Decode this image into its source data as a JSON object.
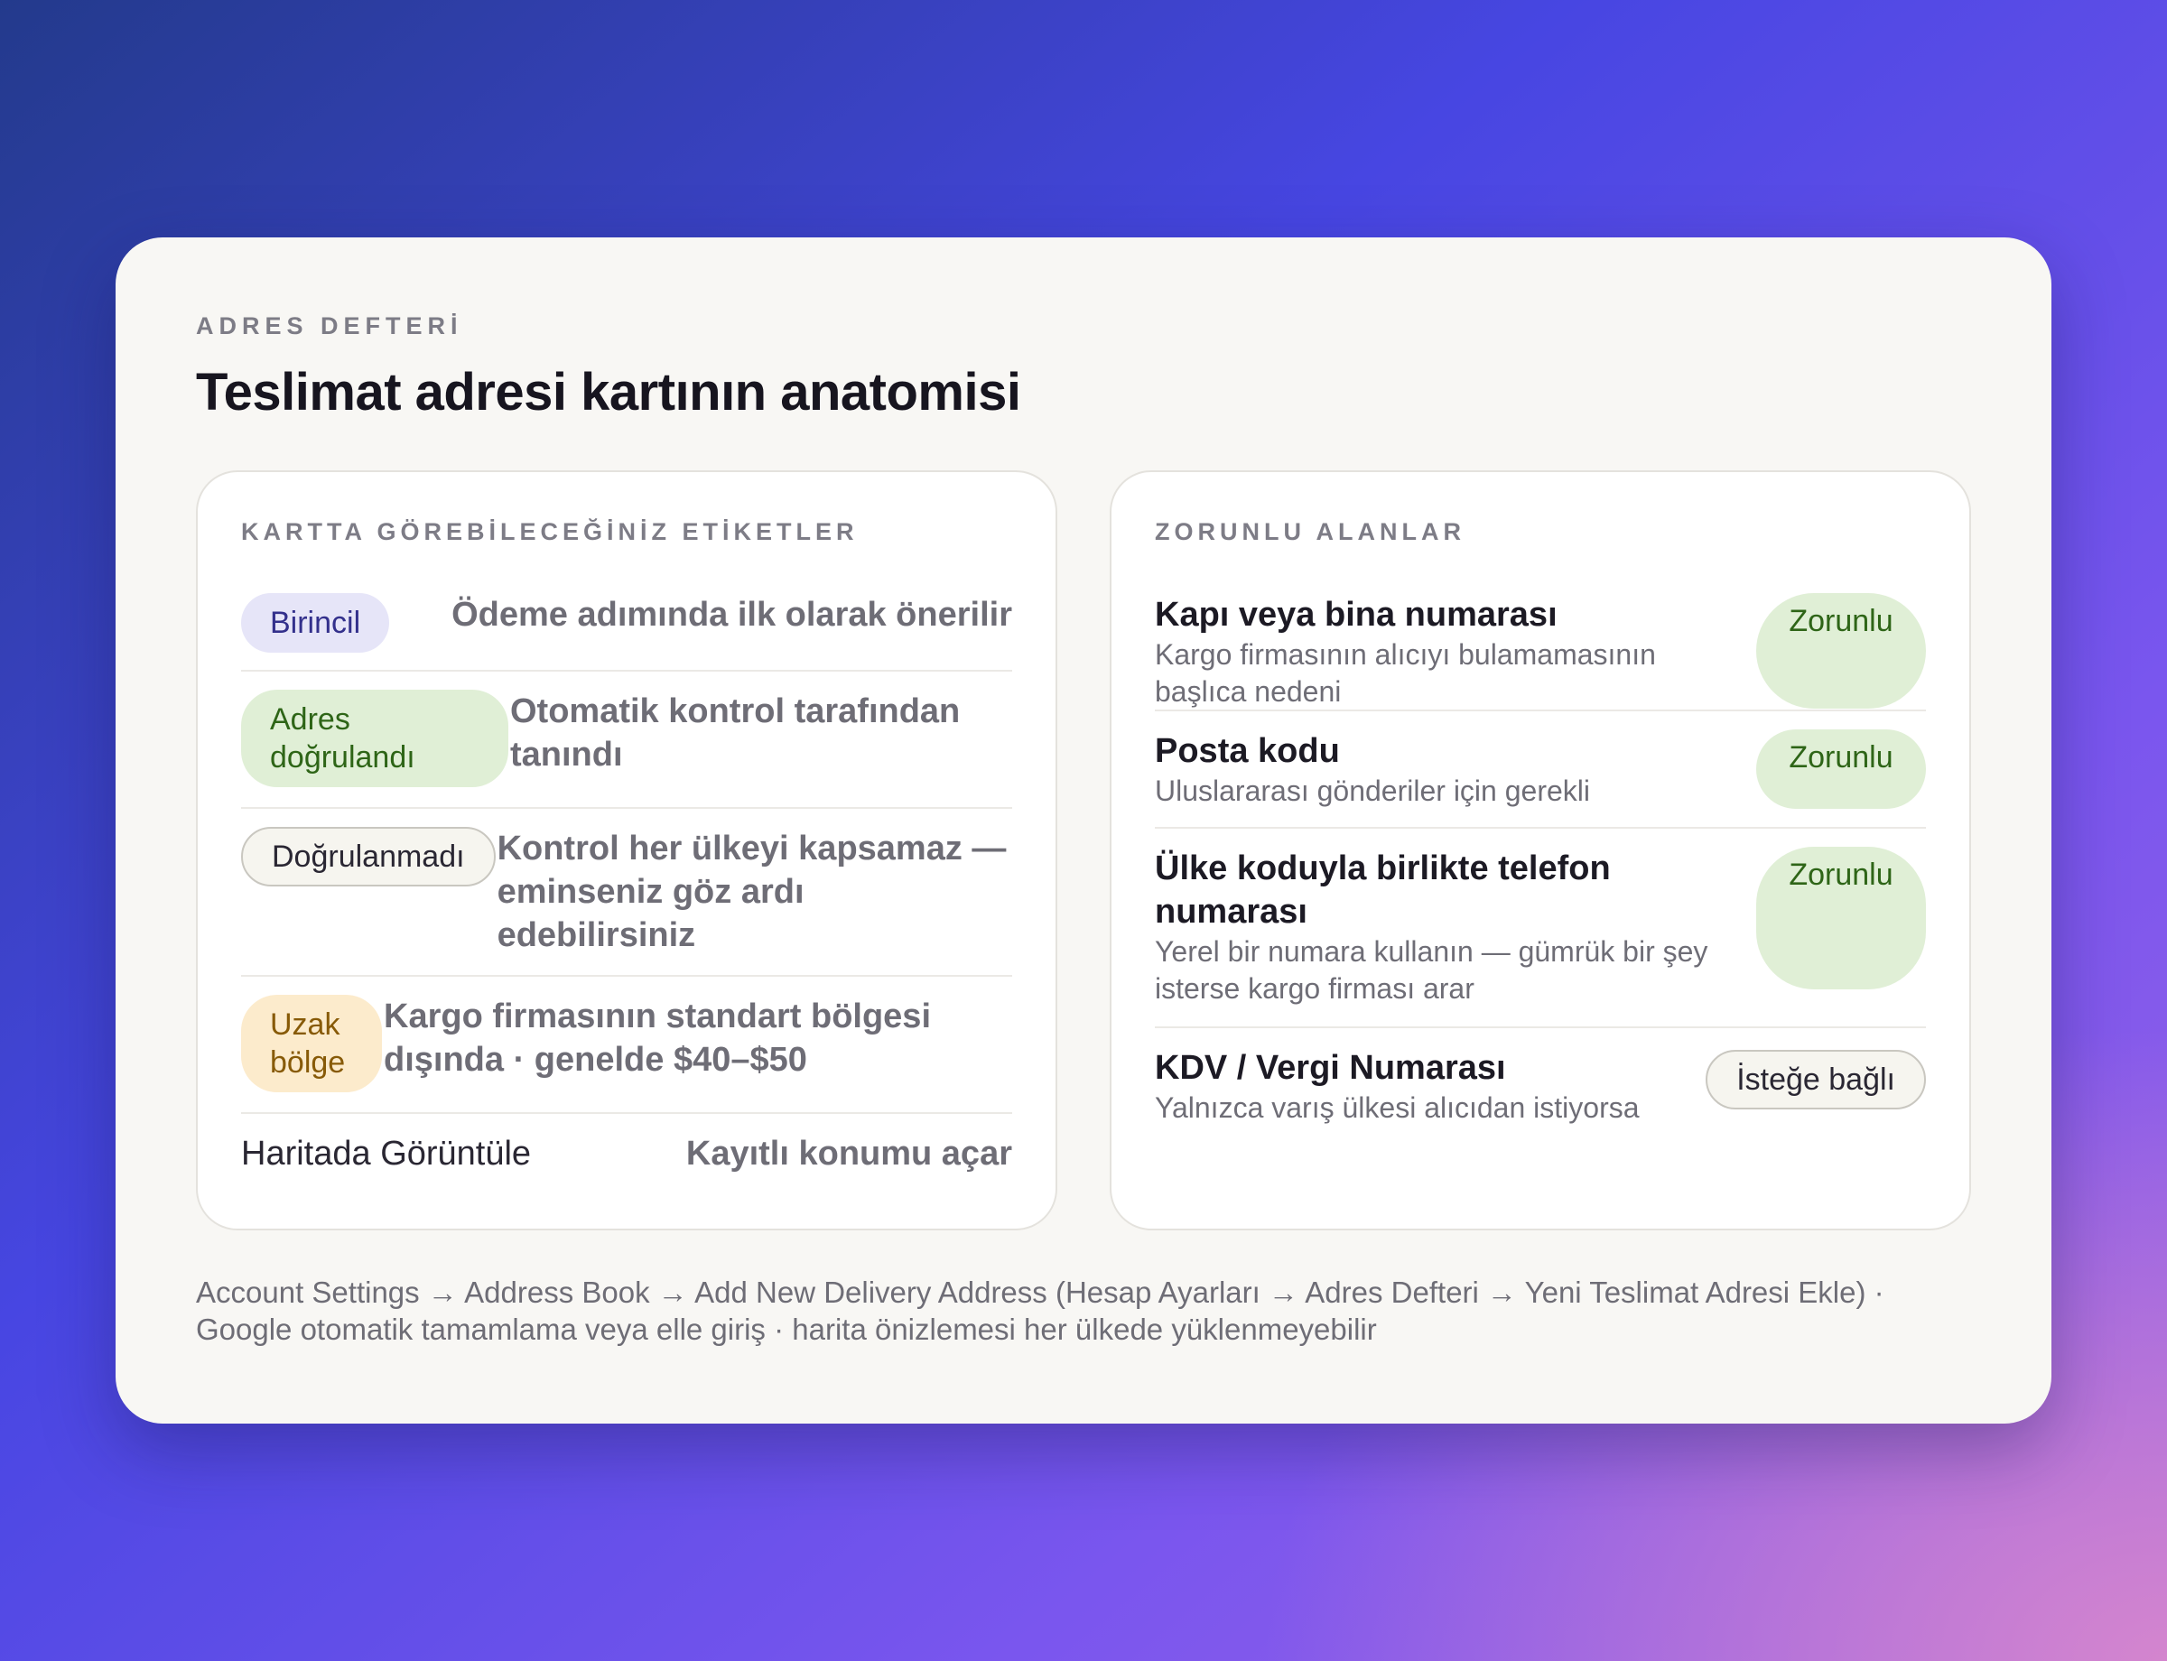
{
  "header": {
    "eyebrow": "ADRES DEFTERİ",
    "title": "Teslimat adresi kartının anatomisi"
  },
  "tags_panel": {
    "heading": "KARTTA GÖREBİLECEĞİNİZ ETİKETLER",
    "rows": [
      {
        "label": "Birincil",
        "description": "Ödeme adımında ilk olarak önerilir"
      },
      {
        "label": "Adres doğrulandı",
        "description": "Otomatik kontrol tarafından tanındı"
      },
      {
        "label": "Doğrulanmadı",
        "description": "Kontrol her ülkeyi kapsamaz — eminseniz göz ardı edebilirsiniz"
      },
      {
        "label": "Uzak bölge",
        "description": "Kargo firmasının standart bölgesi dışında · genelde $40–$50"
      },
      {
        "label": "Haritada Görüntüle",
        "description": "Kayıtlı konumu açar"
      }
    ]
  },
  "fields_panel": {
    "heading": "ZORUNLU ALANLAR",
    "rows": [
      {
        "title": "Kapı veya bina numarası",
        "description": "Kargo firmasının alıcıyı bulamamasının başlıca nedeni",
        "status": "Zorunlu"
      },
      {
        "title": "Posta kodu",
        "description": "Uluslararası gönderiler için gerekli",
        "status": "Zorunlu"
      },
      {
        "title": "Ülke koduyla birlikte telefon numarası",
        "description": "Yerel bir numara kullanın — gümrük bir şey isterse kargo firması arar",
        "status": "Zorunlu"
      },
      {
        "title": "KDV / Vergi Numarası",
        "description": "Yalnızca varış ülkesi alıcıdan istiyorsa",
        "status": "İsteğe bağlı"
      }
    ]
  },
  "footnote": "Account Settings → Address Book → Add New Delivery Address (Hesap Ayarları → Adres Defteri → Yeni Teslimat Adresi Ekle) · Google otomatik tamamlama veya elle giriş · harita önizlemesi her ülkede yüklenmeyebilir",
  "colors": {
    "primary_pill": "#e6e5f8",
    "verified_pill": "#e0efd6",
    "remote_pill": "#fcebcc",
    "required_badge": "#e0efd6"
  }
}
